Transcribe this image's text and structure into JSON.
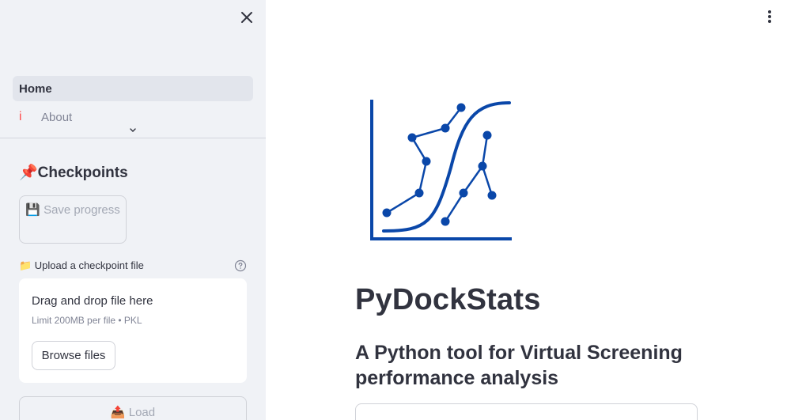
{
  "sidebar": {
    "nav": [
      {
        "label": "Home",
        "icon": "",
        "active": true
      },
      {
        "label": "About",
        "icon": "i",
        "active": false
      }
    ],
    "checkpoints_title": "📌Checkpoints",
    "save_button_label": "💾 Save progress",
    "upload_label": "📁 Upload a checkpoint file",
    "dropzone": {
      "title": "Drag and drop file here",
      "limit": "Limit 200MB per file • PKL",
      "browse_label": "Browse files"
    },
    "load_button_label": "📤 Load"
  },
  "main": {
    "title": "PyDockStats",
    "subtitle": "A Python tool for Virtual Screening performance analysis"
  },
  "colors": {
    "logo_blue": "#0a47a9",
    "accent_red": "#ff4b4b",
    "sidebar_bg": "#f0f2f6"
  },
  "icons": {
    "close": "close-icon",
    "expand": "chevron-down-icon",
    "help": "help-circle-icon",
    "menu": "kebab-menu-icon",
    "logo": "pydockstats-logo"
  }
}
